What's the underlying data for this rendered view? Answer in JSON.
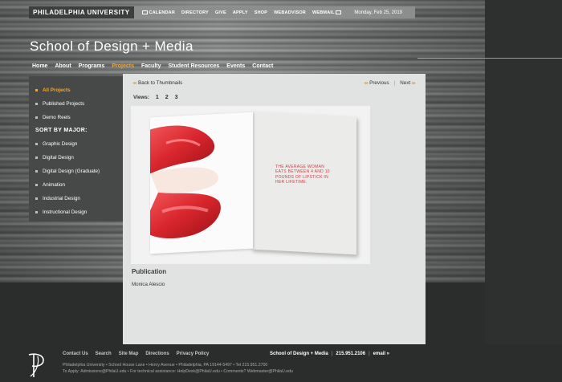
{
  "topbar": {
    "university": "PHILADELPHIA UNIVERSITY",
    "links": [
      "CALENDAR",
      "DIRECTORY",
      "GIVE",
      "APPLY",
      "SHOP",
      "WEBADVISOR",
      "WEBMAIL"
    ],
    "date": "Monday, Feb 25, 2019"
  },
  "site_title": "School of Design + Media",
  "nav": [
    "Home",
    "About",
    "Programs",
    "Projects",
    "Faculty",
    "Student Resources",
    "Events",
    "Contact"
  ],
  "nav_active": "Projects",
  "sidebar": {
    "items_top": [
      "All Projects",
      "Published Projects",
      "Demo Reels"
    ],
    "heading": "SORT BY MAJOR:",
    "majors": [
      "Graphic Design",
      "Digital Design",
      "Digital Design (Graduate)",
      "Animation",
      "Industrial Design",
      "Instructional Design"
    ]
  },
  "content": {
    "back": "Back to Thumbnails",
    "previous": "Previous",
    "separator": "|",
    "next": "Next",
    "views_label": "Views:",
    "views": [
      "1",
      "2",
      "3"
    ],
    "art_quote": "THE AVERAGE WOMAN EATS BETWEEN 4 AND 10 POUNDS OF LIPSTICK IN HER LIFETIME.",
    "category": "Publication",
    "author": "Monica Alescio"
  },
  "footer": {
    "links": [
      "Contact Us",
      "Search",
      "Site Map",
      "Directions",
      "Privacy Policy"
    ],
    "school": "School of Design + Media",
    "divider": "|",
    "phone": "215.951.2106",
    "email": "email »",
    "address": "Philadelphia University • School House Lane • Henry Avenue • Philadelphia, PA 19144-5497 • Tel 215.951.2700",
    "contact": "To Apply: Admissions@PhilaU.edu • For technical assistance: HelpDesk@PhilaU.edu • Comments? Webmaster@PhilaU.edu"
  },
  "colors": {
    "accent": "#f6a623",
    "sidebar": "#474948",
    "panel": "#e0e3e2",
    "quote": "#d43a43"
  }
}
